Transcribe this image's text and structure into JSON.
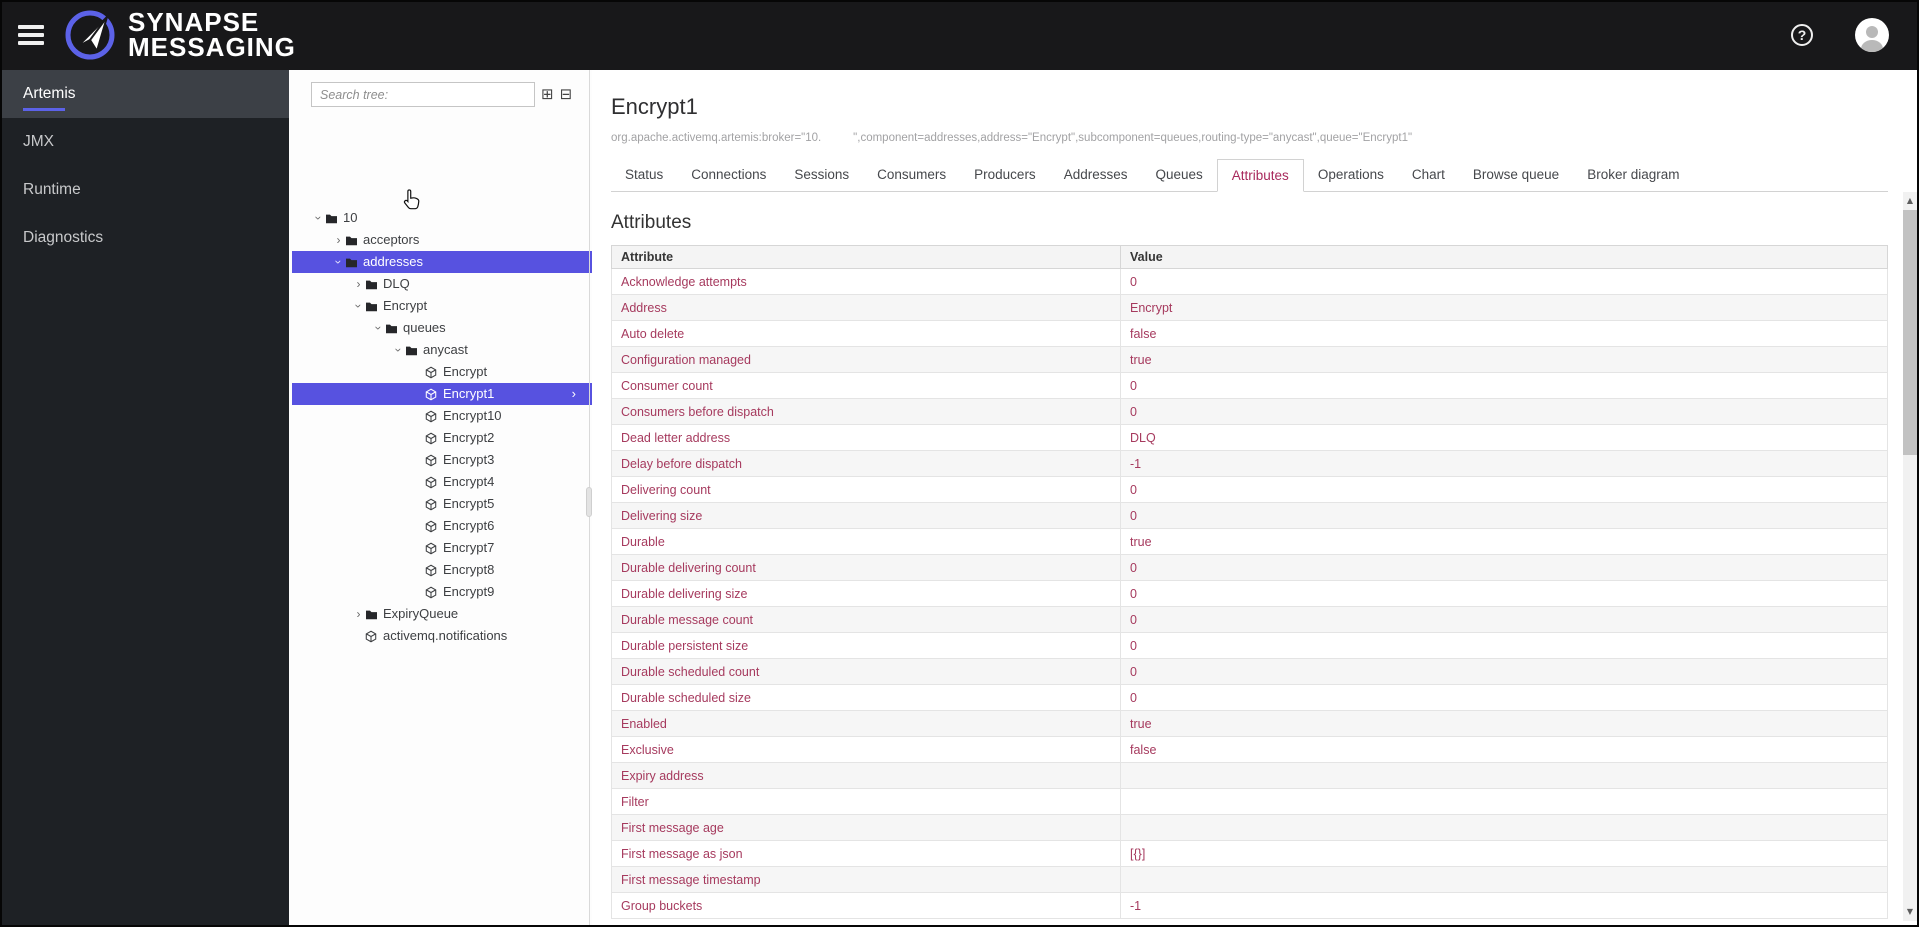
{
  "colors": {
    "header_bg": "#18181a",
    "sidebar_bg": "#1e2125",
    "sidebar_active_bg": "#3c4046",
    "accent": "#5c62e8",
    "selection": "#5752e0",
    "attribute_text": "#a63a5e",
    "tab_active": "#a8295c"
  },
  "header": {
    "brand_line1": "SYNAPSE",
    "brand_line2": "MESSAGING",
    "icons": [
      "menu-icon",
      "paper-plane-logo",
      "help-icon",
      "user-avatar"
    ]
  },
  "sidebar": {
    "items": [
      {
        "label": "Artemis",
        "active": true
      },
      {
        "label": "JMX",
        "active": false
      },
      {
        "label": "Runtime",
        "active": false
      },
      {
        "label": "Diagnostics",
        "active": false
      }
    ]
  },
  "tree": {
    "search_placeholder": "Search tree:",
    "expand_all_icon": "⊞",
    "collapse_all_icon": "⊟",
    "nodes": [
      {
        "label": "10",
        "type": "folder",
        "state": "expanded",
        "level": 0,
        "selected": false
      },
      {
        "label": "acceptors",
        "type": "folder",
        "state": "collapsed",
        "level": 1,
        "selected": false
      },
      {
        "label": "addresses",
        "type": "folder",
        "state": "expanded",
        "level": 1,
        "selected": true
      },
      {
        "label": "DLQ",
        "type": "folder",
        "state": "collapsed",
        "level": 2,
        "selected": false
      },
      {
        "label": "Encrypt",
        "type": "folder",
        "state": "expanded",
        "level": 2,
        "selected": false
      },
      {
        "label": "queues",
        "type": "folder",
        "state": "expanded",
        "level": 3,
        "selected": false
      },
      {
        "label": "anycast",
        "type": "folder",
        "state": "expanded",
        "level": 4,
        "selected": false
      },
      {
        "label": "Encrypt",
        "type": "queue",
        "state": "leaf",
        "level": 5,
        "selected": false
      },
      {
        "label": "Encrypt1",
        "type": "queue",
        "state": "leaf",
        "level": 5,
        "selected": true,
        "chevron": "›"
      },
      {
        "label": "Encrypt10",
        "type": "queue",
        "state": "leaf",
        "level": 5,
        "selected": false
      },
      {
        "label": "Encrypt2",
        "type": "queue",
        "state": "leaf",
        "level": 5,
        "selected": false
      },
      {
        "label": "Encrypt3",
        "type": "queue",
        "state": "leaf",
        "level": 5,
        "selected": false
      },
      {
        "label": "Encrypt4",
        "type": "queue",
        "state": "leaf",
        "level": 5,
        "selected": false
      },
      {
        "label": "Encrypt5",
        "type": "queue",
        "state": "leaf",
        "level": 5,
        "selected": false
      },
      {
        "label": "Encrypt6",
        "type": "queue",
        "state": "leaf",
        "level": 5,
        "selected": false
      },
      {
        "label": "Encrypt7",
        "type": "queue",
        "state": "leaf",
        "level": 5,
        "selected": false
      },
      {
        "label": "Encrypt8",
        "type": "queue",
        "state": "leaf",
        "level": 5,
        "selected": false
      },
      {
        "label": "Encrypt9",
        "type": "queue",
        "state": "leaf",
        "level": 5,
        "selected": false
      },
      {
        "label": "ExpiryQueue",
        "type": "folder",
        "state": "collapsed",
        "level": 2,
        "selected": false
      },
      {
        "label": "activemq.notifications",
        "type": "queue",
        "state": "leaf",
        "level": 2,
        "selected": false
      }
    ]
  },
  "main": {
    "title": "Encrypt1",
    "object_name": "org.apache.activemq.artemis:broker=\"10.          \",component=addresses,address=\"Encrypt\",subcomponent=queues,routing-type=\"anycast\",queue=\"Encrypt1\"",
    "tabs": [
      {
        "label": "Status",
        "active": false
      },
      {
        "label": "Connections",
        "active": false
      },
      {
        "label": "Sessions",
        "active": false
      },
      {
        "label": "Consumers",
        "active": false
      },
      {
        "label": "Producers",
        "active": false
      },
      {
        "label": "Addresses",
        "active": false
      },
      {
        "label": "Queues",
        "active": false
      },
      {
        "label": "Attributes",
        "active": true
      },
      {
        "label": "Operations",
        "active": false
      },
      {
        "label": "Chart",
        "active": false
      },
      {
        "label": "Browse queue",
        "active": false
      },
      {
        "label": "Broker diagram",
        "active": false
      }
    ],
    "section_title": "Attributes",
    "table": {
      "columns": [
        "Attribute",
        "Value"
      ],
      "rows": [
        {
          "attribute": "Acknowledge attempts",
          "value": "0"
        },
        {
          "attribute": "Address",
          "value": "Encrypt"
        },
        {
          "attribute": "Auto delete",
          "value": "false"
        },
        {
          "attribute": "Configuration managed",
          "value": "true"
        },
        {
          "attribute": "Consumer count",
          "value": "0"
        },
        {
          "attribute": "Consumers before dispatch",
          "value": "0"
        },
        {
          "attribute": "Dead letter address",
          "value": "DLQ"
        },
        {
          "attribute": "Delay before dispatch",
          "value": "-1"
        },
        {
          "attribute": "Delivering count",
          "value": "0"
        },
        {
          "attribute": "Delivering size",
          "value": "0"
        },
        {
          "attribute": "Durable",
          "value": "true"
        },
        {
          "attribute": "Durable delivering count",
          "value": "0"
        },
        {
          "attribute": "Durable delivering size",
          "value": "0"
        },
        {
          "attribute": "Durable message count",
          "value": "0"
        },
        {
          "attribute": "Durable persistent size",
          "value": "0"
        },
        {
          "attribute": "Durable scheduled count",
          "value": "0"
        },
        {
          "attribute": "Durable scheduled size",
          "value": "0"
        },
        {
          "attribute": "Enabled",
          "value": "true"
        },
        {
          "attribute": "Exclusive",
          "value": "false"
        },
        {
          "attribute": "Expiry address",
          "value": ""
        },
        {
          "attribute": "Filter",
          "value": ""
        },
        {
          "attribute": "First message age",
          "value": ""
        },
        {
          "attribute": "First message as json",
          "value": "[{}]"
        },
        {
          "attribute": "First message timestamp",
          "value": ""
        },
        {
          "attribute": "Group buckets",
          "value": "-1"
        }
      ]
    }
  }
}
